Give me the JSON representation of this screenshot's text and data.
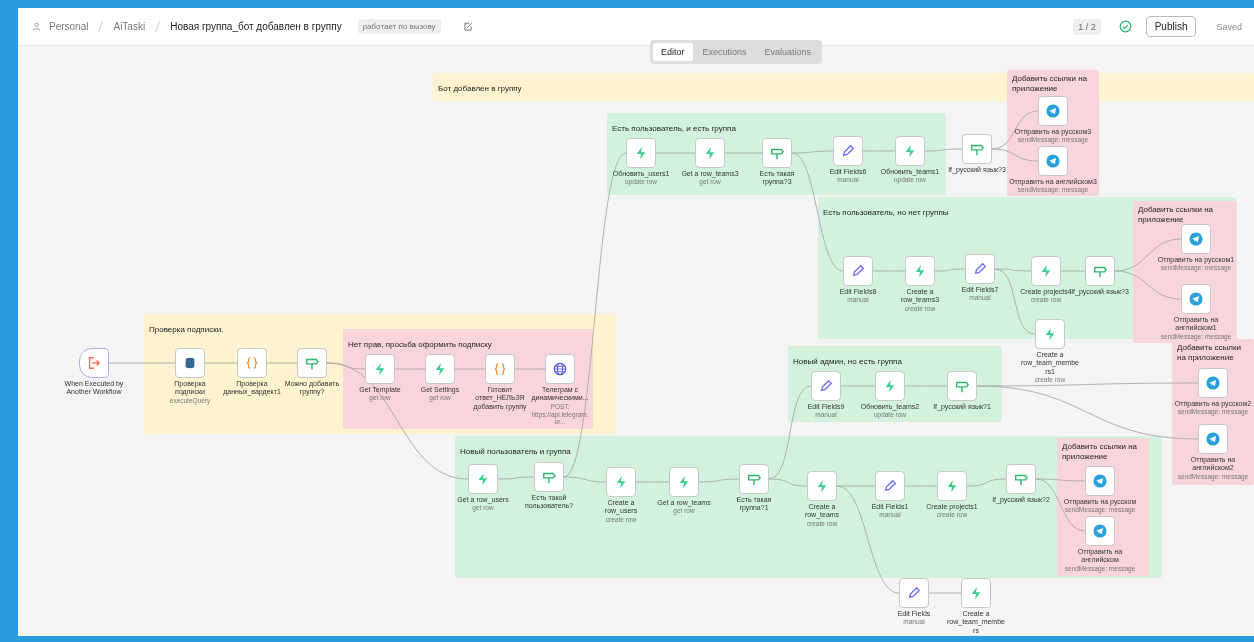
{
  "breadcrumb": {
    "owner": "Personal",
    "project": "AiTaski",
    "workflow": "Новая группа_бот добавлен в группу"
  },
  "tag": "работает по вызову",
  "header_right": {
    "version": "1 / 2",
    "publish": "Publish",
    "save_status": "Saved"
  },
  "tabs": [
    {
      "label": "Editor",
      "selected": true
    },
    {
      "label": "Executions",
      "selected": false
    },
    {
      "label": "Evaluations",
      "selected": false
    }
  ],
  "sticky_notes": [
    {
      "title": "Бот добавлен в группу",
      "color": "#fff3cf"
    },
    {
      "title": "Добавить ссылки на приложение",
      "color": "#f8d5da"
    },
    {
      "title": "Есть пользователь, и есть группа",
      "color": "#d3f2dd"
    },
    {
      "title": "Есть пользователь, но нет группы",
      "color": "#d3f2dd"
    },
    {
      "title": "Добавить ссылки на приложение",
      "color": "#f8d5da"
    },
    {
      "title": "Проверка подписки.",
      "color": "#fff3cf"
    },
    {
      "title": "Нет прав, просьба оформить подписку",
      "color": "#f8d5da"
    },
    {
      "title": "Новый админ, но есть группа",
      "color": "#d3f2dd"
    },
    {
      "title": "Добавить ссылки на приложение",
      "color": "#f8d5da"
    },
    {
      "title": "Новый пользователь и группа",
      "color": "#d3f2dd"
    },
    {
      "title": "Добавить ссылки на приложение",
      "color": "#f8d5da"
    }
  ],
  "nodes": [
    {
      "name": "When Executed by Another Workflow",
      "kind": "trigger"
    },
    {
      "name": "Проверка подписки",
      "subtitle": "executeQuery",
      "kind": "postgres"
    },
    {
      "name": "Проверка данных_вардект1",
      "kind": "code"
    },
    {
      "name": "Можно добавить группу?",
      "kind": "if"
    },
    {
      "name": "Get Template",
      "subtitle": "get row",
      "kind": "supabase"
    },
    {
      "name": "Get Settings",
      "subtitle": "get row",
      "kind": "supabase"
    },
    {
      "name": "Готовит ответ_НЕЛЬЗЯ добавить группу",
      "kind": "code"
    },
    {
      "name": "Телеграм с динамическими...",
      "subtitle": "POST: https://api.telegram.or...",
      "kind": "http"
    },
    {
      "name": "Обновить_users1",
      "subtitle": "update row",
      "kind": "supabase"
    },
    {
      "name": "Get a row_teams3",
      "subtitle": "get row",
      "kind": "supabase"
    },
    {
      "name": "Есть такая группа?3",
      "kind": "if"
    },
    {
      "name": "Edit Fields6",
      "subtitle": "manual",
      "kind": "set"
    },
    {
      "name": "Обновить_teams1",
      "subtitle": "update row",
      "kind": "supabase"
    },
    {
      "name": "If_русский язык?3",
      "kind": "if"
    },
    {
      "name": "Отправить на русском3",
      "subtitle": "sendMessage: message",
      "kind": "telegram"
    },
    {
      "name": "Отправить на английском3",
      "subtitle": "sendMessage: message",
      "kind": "telegram"
    },
    {
      "name": "Edit Fields8",
      "subtitle": "manual",
      "kind": "set"
    },
    {
      "name": "Create a row_teams3",
      "subtitle": "create row",
      "kind": "supabase"
    },
    {
      "name": "Edit Fields7",
      "subtitle": "manual",
      "kind": "set"
    },
    {
      "name": "Create projects4",
      "subtitle": "create row",
      "kind": "supabase"
    },
    {
      "name": "If_русский язык?3",
      "kind": "if"
    },
    {
      "name": "Отправить на русском1",
      "subtitle": "sendMessage: message",
      "kind": "telegram"
    },
    {
      "name": "Отправить на английском1",
      "subtitle": "sendMessage: message",
      "kind": "telegram"
    },
    {
      "name": "Create a row_team_members1",
      "subtitle": "create row",
      "kind": "supabase"
    },
    {
      "name": "Edit Fields9",
      "subtitle": "manual",
      "kind": "set"
    },
    {
      "name": "Обновить_teams2",
      "subtitle": "update row",
      "kind": "supabase"
    },
    {
      "name": "If_русский язык?1",
      "kind": "if"
    },
    {
      "name": "Отправить на русском2",
      "subtitle": "sendMessage: message",
      "kind": "telegram"
    },
    {
      "name": "Отправить на английском2",
      "subtitle": "sendMessage: message",
      "kind": "telegram"
    },
    {
      "name": "Get a row_users",
      "subtitle": "get row",
      "kind": "supabase"
    },
    {
      "name": "Есть такой пользователь?",
      "kind": "if"
    },
    {
      "name": "Create a row_users",
      "subtitle": "create row",
      "kind": "supabase"
    },
    {
      "name": "Get a row_teams",
      "subtitle": "get row",
      "kind": "supabase"
    },
    {
      "name": "Есть такая группа?1",
      "kind": "if"
    },
    {
      "name": "Create a row_teams",
      "subtitle": "create row",
      "kind": "supabase"
    },
    {
      "name": "Edit Fields1",
      "subtitle": "manual",
      "kind": "set"
    },
    {
      "name": "Create projects1",
      "subtitle": "create row",
      "kind": "supabase"
    },
    {
      "name": "If_русский язык?2",
      "kind": "if"
    },
    {
      "name": "Отправить на русском",
      "subtitle": "sendMessage: message",
      "kind": "telegram"
    },
    {
      "name": "Отправить на английском",
      "subtitle": "sendMessage: message",
      "kind": "telegram"
    },
    {
      "name": "Edit Fields",
      "subtitle": "manual",
      "kind": "set"
    },
    {
      "name": "Create a row_team_members",
      "kind": "supabase"
    }
  ]
}
